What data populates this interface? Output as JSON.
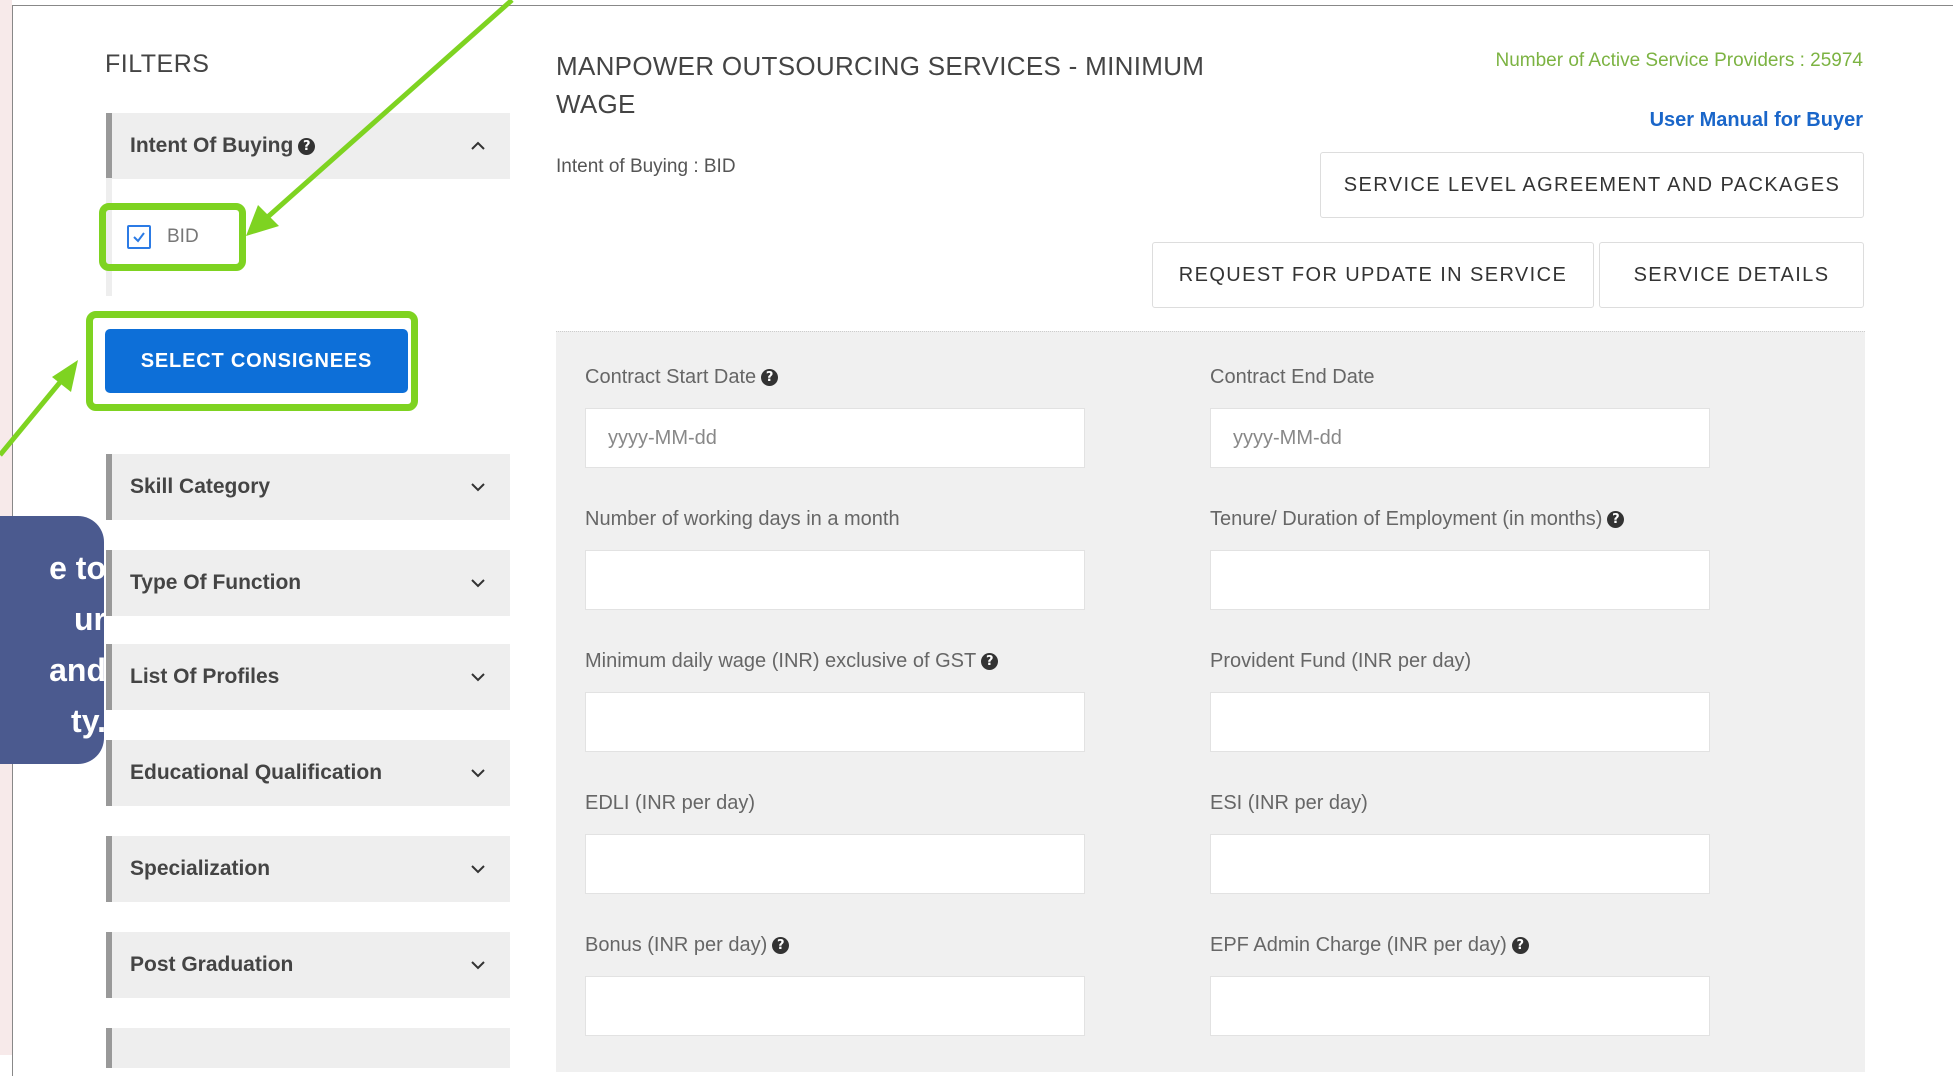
{
  "filters": {
    "title": "FILTERS",
    "intent_panel": {
      "label": "Intent Of Buying"
    },
    "bid_option": {
      "label": "BID",
      "checked": true
    },
    "select_consignees_label": "SELECT CONSIGNEES",
    "panels": [
      {
        "label": "Skill Category"
      },
      {
        "label": "Type Of Function"
      },
      {
        "label": "List Of Profiles"
      },
      {
        "label": "Educational Qualification"
      },
      {
        "label": "Specialization"
      },
      {
        "label": "Post Graduation"
      }
    ]
  },
  "callout": {
    "lines": [
      "e to",
      "ur",
      "and",
      "ty."
    ]
  },
  "main": {
    "title": "MANPOWER OUTSOURCING SERVICES - MINIMUM WAGE",
    "intent_text": "Intent of Buying : BID",
    "active_providers": "Number of Active Service Providers : 25974",
    "user_manual": "User Manual for Buyer",
    "sla_button": "SERVICE LEVEL AGREEMENT AND PACKAGES",
    "request_update_button": "REQUEST FOR UPDATE IN SERVICE",
    "service_details_button": "SERVICE DETAILS"
  },
  "form": {
    "contract_start": {
      "label": "Contract Start Date",
      "placeholder": "yyyy-MM-dd"
    },
    "contract_end": {
      "label": "Contract End Date",
      "placeholder": "yyyy-MM-dd"
    },
    "working_days": {
      "label": "Number of working days in a month"
    },
    "tenure": {
      "label": "Tenure/ Duration of Employment (in months)"
    },
    "min_wage": {
      "label": "Minimum daily wage (INR) exclusive of GST"
    },
    "provident_fund": {
      "label": "Provident Fund (INR per day)"
    },
    "edli": {
      "label": "EDLI (INR per day)"
    },
    "esi": {
      "label": "ESI (INR per day)"
    },
    "bonus": {
      "label": "Bonus (INR per day)"
    },
    "epf_admin": {
      "label": "EPF Admin Charge (INR per day)"
    }
  },
  "colors": {
    "highlight": "#7ed321",
    "primary_button": "#0d6fd8",
    "callout_bg": "#4b5a8f",
    "providers_text": "#7cb342",
    "link_blue": "#1a66c9"
  },
  "icons": {
    "help": "question-circle-icon",
    "chevron_up": "chevron-up-icon",
    "chevron_down": "chevron-down-icon",
    "check": "check-icon"
  }
}
